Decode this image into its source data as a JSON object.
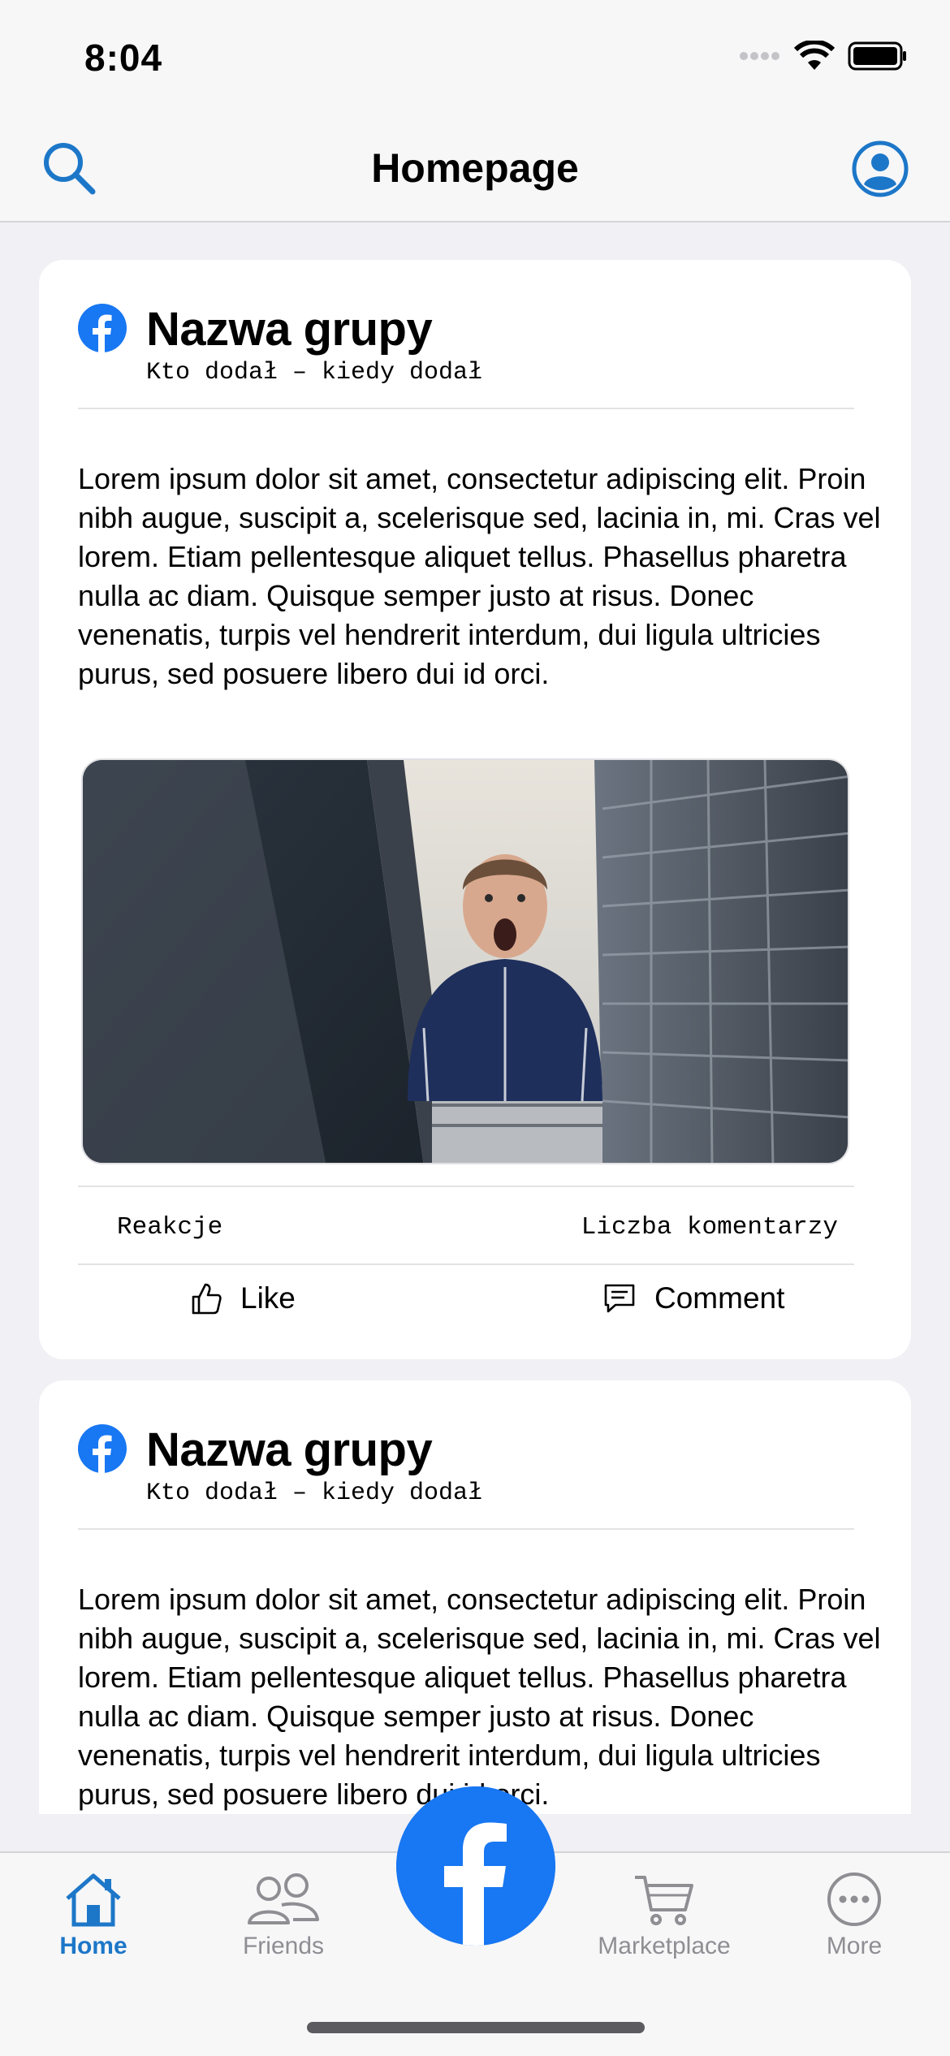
{
  "status": {
    "time": "8:04"
  },
  "nav": {
    "title": "Homepage"
  },
  "posts": [
    {
      "group_name": "Nazwa grupy",
      "meta": "Kto dodał – kiedy dodał",
      "text": "Lorem ipsum dolor sit amet, consectetur adipiscing elit. Proin nibh augue, suscipit a, scelerisque sed, lacinia in, mi. Cras vel lorem. Etiam pellentesque aliquet tellus. Phasellus pharetra nulla ac diam. Quisque semper justo at risus. Donec venenatis, turpis vel hendrerit interdum, dui ligula ultricies purus, sed posuere libero dui id orci.",
      "reactions_label": "Reakcje",
      "comments_label": "Liczba komentarzy",
      "like_label": "Like",
      "comment_label": "Comment"
    },
    {
      "group_name": "Nazwa grupy",
      "meta": "Kto dodał – kiedy dodał",
      "text": "Lorem ipsum dolor sit amet, consectetur adipiscing elit. Proin nibh augue, suscipit a, scelerisque sed, lacinia in, mi. Cras vel lorem. Etiam pellentesque aliquet tellus. Phasellus pharetra nulla ac diam. Quisque semper justo at risus. Donec venenatis, turpis vel hendrerit interdum, dui ligula ultricies purus, sed posuere libero dui id orci."
    }
  ],
  "tabs": {
    "home": "Home",
    "friends": "Friends",
    "marketplace": "Marketplace",
    "more": "More"
  },
  "colors": {
    "accent": "#1d77c8",
    "facebook_blue": "#1877f2",
    "inactive": "#8e8e93"
  },
  "icons": [
    "search-icon",
    "profile-icon",
    "facebook-logo-icon",
    "like-icon",
    "comment-icon",
    "home-icon",
    "friends-icon",
    "cart-icon",
    "more-icon"
  ]
}
